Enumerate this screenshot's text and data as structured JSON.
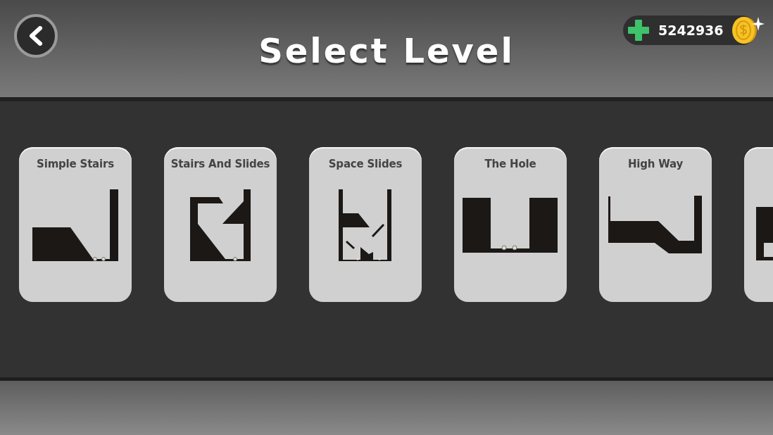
{
  "header": {
    "title": "Select Level",
    "coins": "5242936"
  },
  "levels": [
    {
      "title": "Simple Stairs",
      "kind": "stairs"
    },
    {
      "title": "Stairs And Slides",
      "kind": "stairs-slides"
    },
    {
      "title": "Space Slides",
      "kind": "space-slides"
    },
    {
      "title": "The Hole",
      "kind": "hole"
    },
    {
      "title": "High Way",
      "kind": "highway"
    },
    {
      "kind": "blocks"
    }
  ]
}
